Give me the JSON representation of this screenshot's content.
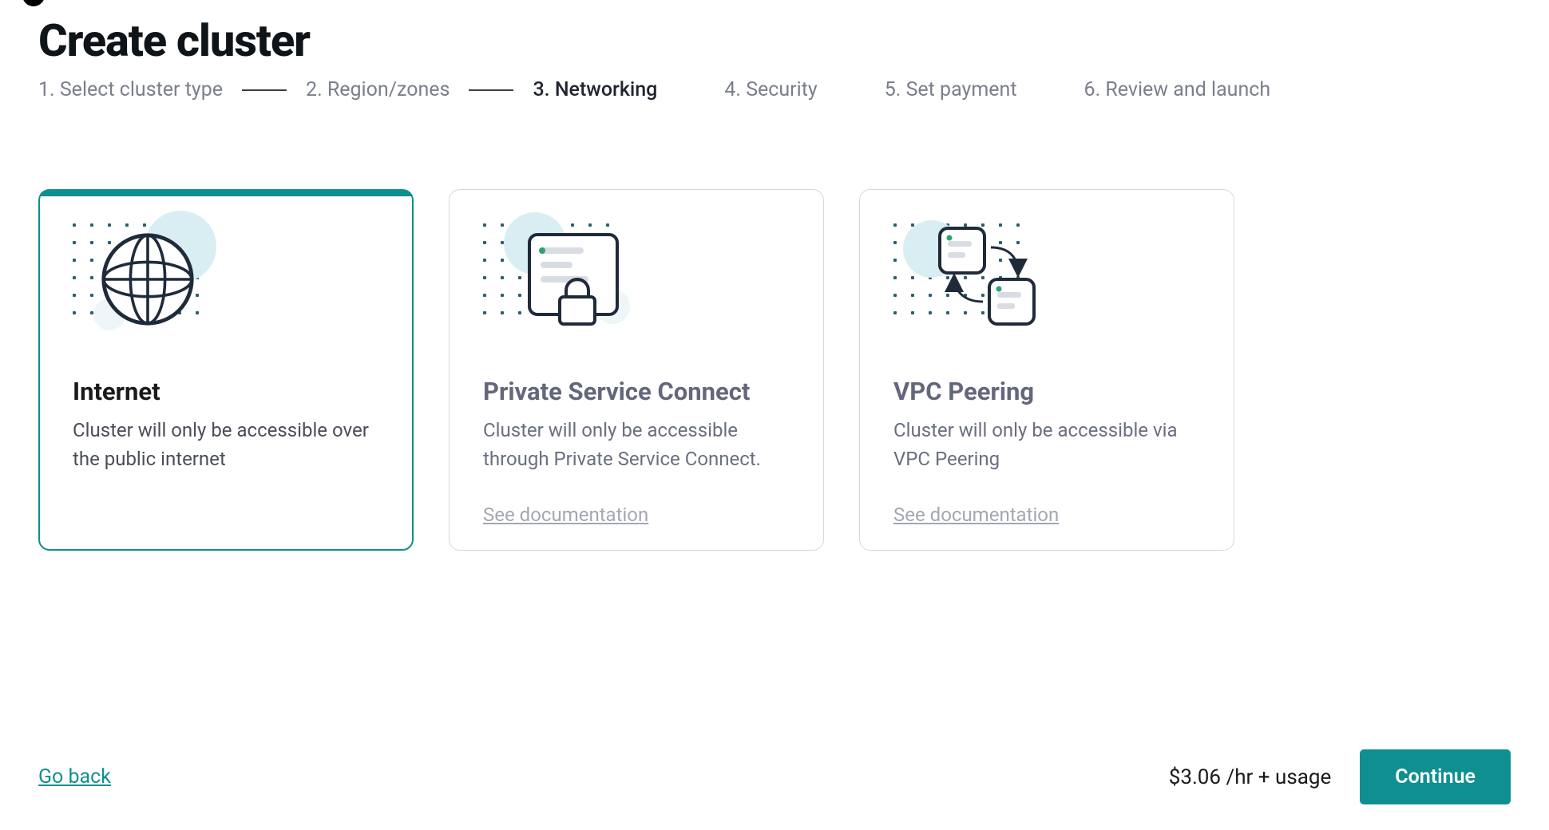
{
  "page": {
    "title": "Create cluster"
  },
  "steps": [
    {
      "label": "1. Select cluster type",
      "state": "done"
    },
    {
      "label": "2. Region/zones",
      "state": "done"
    },
    {
      "label": "3. Networking",
      "state": "current"
    },
    {
      "label": "4. Security",
      "state": "upcoming"
    },
    {
      "label": "5. Set payment",
      "state": "upcoming"
    },
    {
      "label": "6. Review and launch",
      "state": "upcoming"
    }
  ],
  "options": [
    {
      "id": "internet",
      "title": "Internet",
      "description": "Cluster will only be accessible over the public internet",
      "selected": true,
      "doc_link": null
    },
    {
      "id": "psc",
      "title": "Private Service Connect",
      "description": "Cluster will only be accessible through Private Service Connect.",
      "selected": false,
      "doc_link": "See documentation"
    },
    {
      "id": "vpc",
      "title": "VPC Peering",
      "description": "Cluster will only be accessible via VPC Peering",
      "selected": false,
      "doc_link": "See documentation"
    }
  ],
  "footer": {
    "back_label": "Go back",
    "price_text": "$3.06 /hr + usage",
    "continue_label": "Continue"
  }
}
